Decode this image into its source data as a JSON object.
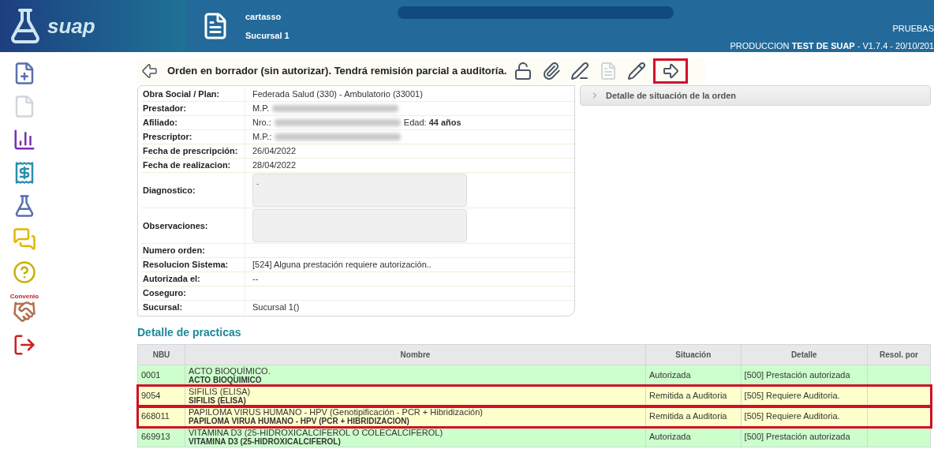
{
  "header": {
    "logo": "suap",
    "user": "cartasso",
    "branch": "Sucursal 1",
    "env": "PRUEBAS",
    "version": "PRODUCCION **TEST DE SUAP** - V1.7.4 - 20/10/201"
  },
  "sidebar": [
    {
      "kind": "doc-add"
    },
    {
      "kind": "doc"
    },
    {
      "kind": "chart"
    },
    {
      "kind": "invoice"
    },
    {
      "kind": "lab"
    },
    {
      "kind": "chat"
    },
    {
      "kind": "help"
    },
    {
      "kind": "deal",
      "label": "Convenio"
    },
    {
      "kind": "exit"
    }
  ],
  "toolbar": {
    "title": "Orden en borrador (sin autorizar). Tendrá remisión parcial a auditoría.",
    "buttons": [
      {
        "kind": "unlock",
        "disabled": false,
        "highlighted": false
      },
      {
        "kind": "clip",
        "disabled": false,
        "highlighted": false
      },
      {
        "kind": "sign",
        "disabled": false,
        "highlighted": false
      },
      {
        "kind": "doc",
        "disabled": true,
        "highlighted": false
      },
      {
        "kind": "edit",
        "disabled": false,
        "highlighted": false
      },
      {
        "kind": "forward",
        "disabled": false,
        "highlighted": true
      }
    ]
  },
  "fields": [
    {
      "label": "Obra Social / Plan:",
      "kind": "text",
      "value": "Federada Salud (330) - Ambulatorio (33001)"
    },
    {
      "label": "Prestador:",
      "kind": "text",
      "prefix": "M.P.",
      "redacted": true
    },
    {
      "label": "Afiliado:",
      "kind": "text",
      "prefix": "Nro.:",
      "redacted": true,
      "suffix": "Edad: **44 años**"
    },
    {
      "label": "Prescriptor:",
      "kind": "text",
      "prefix": "M.P.:",
      "redacted": true
    },
    {
      "label": "Fecha de prescripción:",
      "kind": "text",
      "value": "26/04/2022"
    },
    {
      "label": "Fecha de realizacion:",
      "kind": "text",
      "value": "28/04/2022"
    },
    {
      "label": "Diagnostico:",
      "kind": "textarea",
      "value": "-"
    },
    {
      "label": "Observaciones:",
      "kind": "textarea"
    },
    {
      "label": "Numero orden:",
      "kind": "text"
    },
    {
      "label": "Resolucion Sistema:",
      "kind": "text",
      "value": "[524] Alguna prestación requiere autorización.."
    },
    {
      "label": "Autorizada el:",
      "kind": "text",
      "value": "--"
    },
    {
      "label": "Coseguro:",
      "kind": "text"
    },
    {
      "label": "Sucursal:",
      "kind": "text",
      "value": "Sucursal 1()"
    }
  ],
  "situation_panel": {
    "title": "Detalle de situación de la orden",
    "expanded": false
  },
  "practices": {
    "title": "Detalle de practicas",
    "columns": [
      "NBU",
      "Nombre",
      "Situación",
      "Detalle",
      "Resol. por"
    ],
    "rows": [
      {
        "nbu": "0001",
        "name": "ACTO BIOQUÍMICO.",
        "name_short": "ACTO BIOQUIMICO",
        "situation": "Autorizada",
        "detail": "[500] Prestación autorizada",
        "color": "#ccffcc",
        "highlighted": false
      },
      {
        "nbu": "9054",
        "name": "SIFILIS (ELISA)",
        "name_short": "SIFILIS (ELISA)",
        "situation": "Remitida a Auditoria",
        "detail": "[505] Requiere Auditoria.",
        "color": "#ffffcc",
        "highlighted": true
      },
      {
        "nbu": "668011",
        "name": "PAPILOMA VIRUS HUMANO - HPV (Genotipificación - PCR + Hibridización)",
        "name_short": "PAPILOMA VIRUA HUMANO - HPV (PCR + HIBRIDIZACION)",
        "situation": "Remitida a Auditoria",
        "detail": "[505] Requiere Auditoria.",
        "color": "#ffffcc",
        "highlighted": true
      },
      {
        "nbu": "669913",
        "name": "VITAMINA D3 (25-HIDROXICALCIFEROL O COLECALCIFEROL)",
        "name_short": "VITAMINA D3 (25-HIDROXICALCIFEROL)",
        "situation": "Autorizada",
        "detail": "[500] Prestación autorizada",
        "color": "#ccffcc",
        "highlighted": false
      }
    ]
  }
}
